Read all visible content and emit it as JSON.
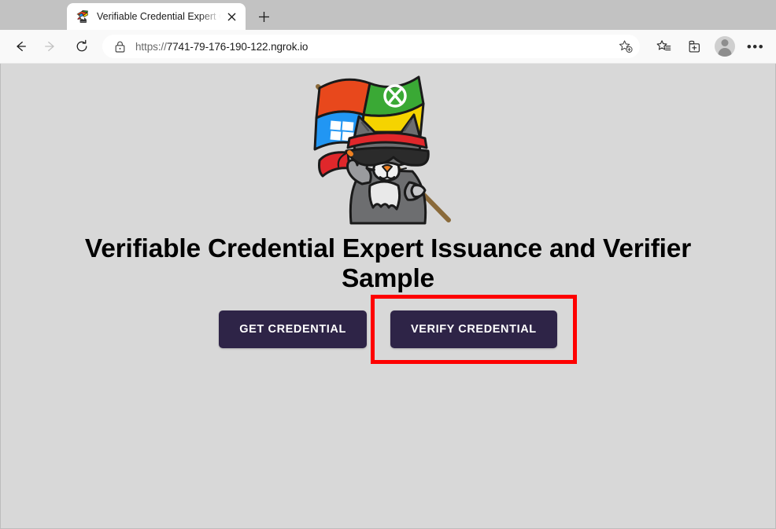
{
  "browser": {
    "tab": {
      "title": "Verifiable Credential Expert Cli",
      "favicon_name": "ninja-cat-favicon",
      "close_label": "×"
    },
    "new_tab_label": "+",
    "nav": {
      "back_label": "Back",
      "forward_label": "Forward",
      "refresh_label": "Refresh"
    },
    "address_bar": {
      "scheme": "https://",
      "host": "7741-79-176-190-122.ngrok.io",
      "full_url": "https://7741-79-176-190-122.ngrok.io",
      "lock_icon": "padlock-icon",
      "favorite_icon": "add-favorite-star-icon"
    },
    "toolbar_icons": [
      {
        "name": "favorites-icon",
        "label": "Favorites"
      },
      {
        "name": "collections-icon",
        "label": "Collections"
      },
      {
        "name": "profile-avatar",
        "label": "Profile"
      },
      {
        "name": "settings-more-icon",
        "label": "Settings and more"
      }
    ],
    "settings_dots": "•••"
  },
  "page": {
    "hero_image_name": "ninja-cat-windows-flag-illustration",
    "heading": "Verifiable Credential Expert Issuance and Verifier Sample",
    "buttons": [
      {
        "name": "get-credential-button",
        "label": "GET CREDENTIAL",
        "highlighted": false
      },
      {
        "name": "verify-credential-button",
        "label": "VERIFY CREDENTIAL",
        "highlighted": true
      }
    ],
    "colors": {
      "background": "#d8d8d8",
      "button": "#2e2447",
      "button_text": "#ffffff",
      "highlight": "#fe0000",
      "heading_text": "#000000"
    }
  }
}
